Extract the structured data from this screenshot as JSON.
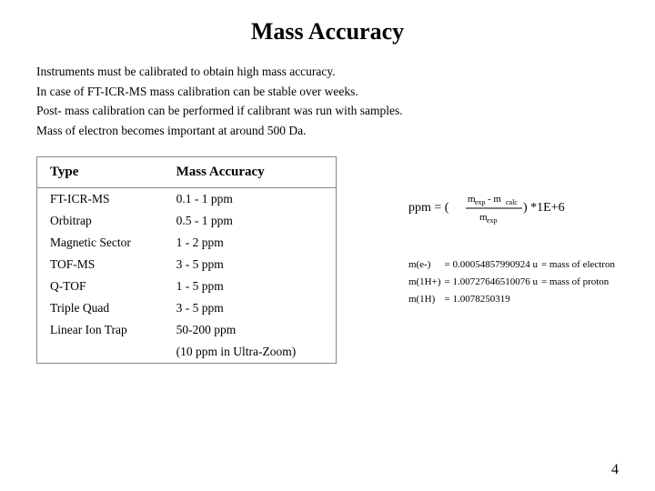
{
  "page": {
    "title": "Mass Accuracy",
    "intro": [
      "Instruments must be calibrated to obtain high mass accuracy.",
      "In case of FT-ICR-MS mass calibration can be stable over weeks.",
      "Post- mass calibration can be performed if calibrant was run with samples.",
      "Mass of electron becomes important at around 500 Da."
    ],
    "table": {
      "headers": [
        "Type",
        "Mass Accuracy"
      ],
      "rows": [
        [
          "FT-ICR-MS",
          "0.1 - 1 ppm"
        ],
        [
          "Orbitrap",
          "0.5 - 1 ppm"
        ],
        [
          "Magnetic Sector",
          "1 - 2 ppm"
        ],
        [
          "TOF-MS",
          "3 - 5 ppm"
        ],
        [
          "Q-TOF",
          "1 - 5 ppm"
        ],
        [
          "Triple Quad",
          "3 - 5 ppm"
        ],
        [
          "Linear Ion Trap",
          "50-200 ppm"
        ],
        [
          "",
          "(10 ppm in Ultra-Zoom)"
        ]
      ]
    },
    "formula": {
      "label": "ppm = (m_exp - m_calc / m_exp) * 1E+6"
    },
    "mass_info": [
      {
        "symbol": "m(e-)",
        "equals": "= 0.00054857990924 u",
        "desc": "= mass of electron"
      },
      {
        "symbol": "m(1H+)",
        "equals": "= 1.00727646510076 u",
        "desc": "= mass of proton"
      },
      {
        "symbol": "m(1H)",
        "equals": "= 1.0078250319",
        "desc": ""
      }
    ],
    "page_number": "4"
  }
}
